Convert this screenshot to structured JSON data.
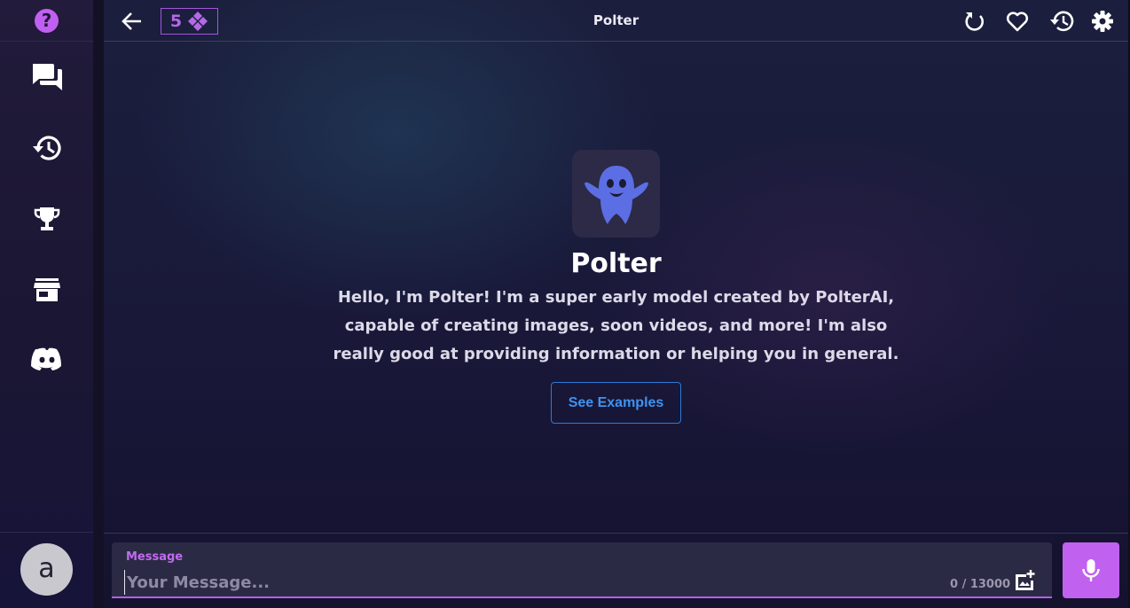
{
  "sidebar": {
    "help_glyph": "?",
    "items": [
      {
        "name": "chats",
        "icon": "chat-bubbles-icon"
      },
      {
        "name": "history",
        "icon": "history-icon"
      },
      {
        "name": "leaderboard",
        "icon": "trophy-icon"
      },
      {
        "name": "store",
        "icon": "store-icon"
      },
      {
        "name": "discord",
        "icon": "discord-icon"
      }
    ],
    "avatar_letter": "a"
  },
  "header": {
    "credits_count": "5",
    "title": "Polter",
    "icons": [
      "refresh-icon",
      "heart-icon",
      "history-icon",
      "gear-icon"
    ]
  },
  "bot": {
    "name": "Polter",
    "description": "Hello, I'm Polter! I'm a super early model created by PolterAI, capable of creating images, soon videos, and more! I'm also really good at providing information or helping you in general.",
    "examples_label": "See Examples"
  },
  "composer": {
    "label": "Message",
    "placeholder": "Your Message...",
    "value": "",
    "char_count": "0 / 13000"
  },
  "colors": {
    "accent": "#c161f0",
    "link_blue": "#3f93f0",
    "background": "#15122d"
  }
}
